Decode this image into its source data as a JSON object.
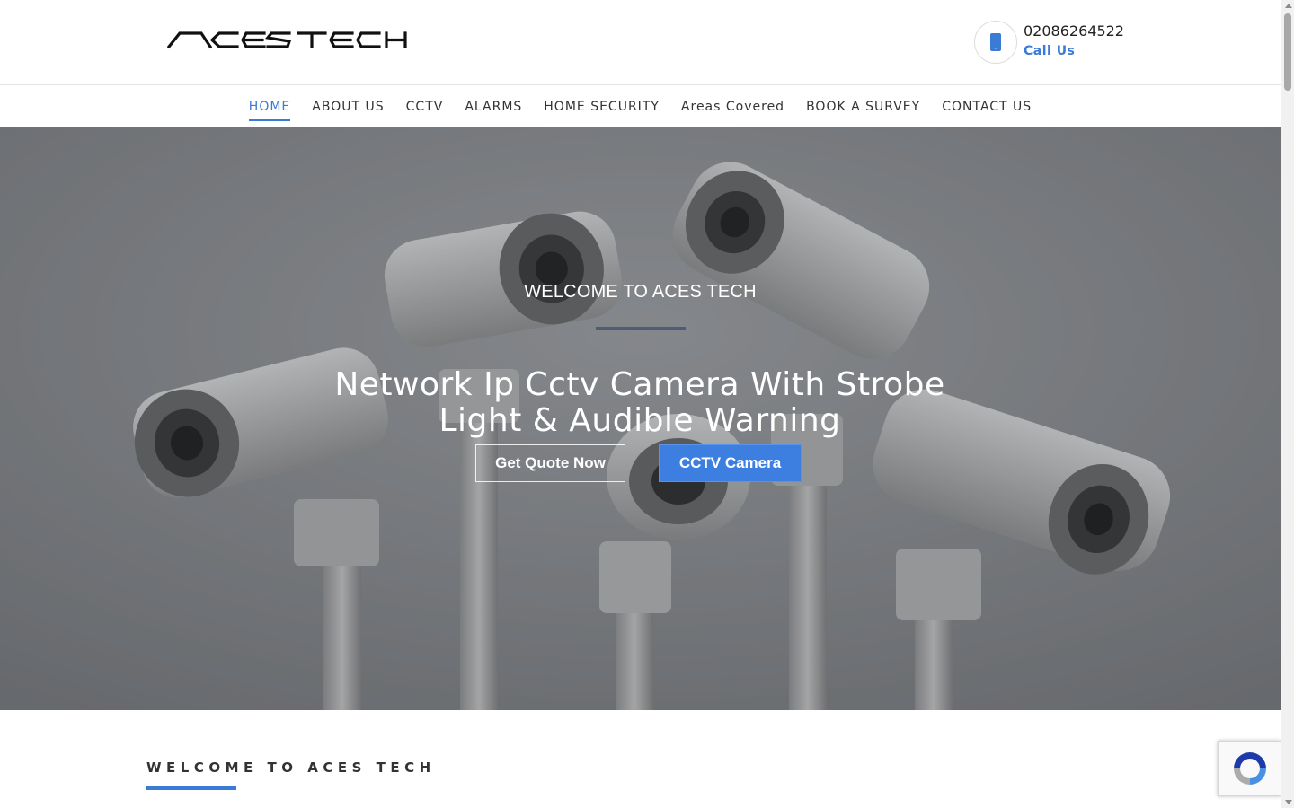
{
  "brand": {
    "logo_text": "ACES TECH",
    "accent_color": "#3a7bd5"
  },
  "contact": {
    "phone_number": "02086264522",
    "call_label": "Call Us",
    "icon": "mobile-phone-icon"
  },
  "nav": {
    "items": [
      {
        "label": "HOME",
        "active": true
      },
      {
        "label": "ABOUT US",
        "active": false
      },
      {
        "label": "CCTV",
        "active": false
      },
      {
        "label": "ALARMS",
        "active": false
      },
      {
        "label": "HOME SECURITY",
        "active": false
      },
      {
        "label": "Areas Covered",
        "active": false
      },
      {
        "label": "BOOK A SURVEY",
        "active": false
      },
      {
        "label": "CONTACT US",
        "active": false
      }
    ]
  },
  "hero": {
    "kicker": "WELCOME TO ACES TECH",
    "title": "Network Ip Cctv Camera With Strobe Light & Audible Warning",
    "primary_button": "Get Quote Now",
    "secondary_button": "CCTV Camera",
    "button_color": "#3d7fe0"
  },
  "welcome": {
    "title": "WELCOME TO ACES TECH"
  },
  "widgets": {
    "recaptcha_icon": "recaptcha-icon"
  }
}
